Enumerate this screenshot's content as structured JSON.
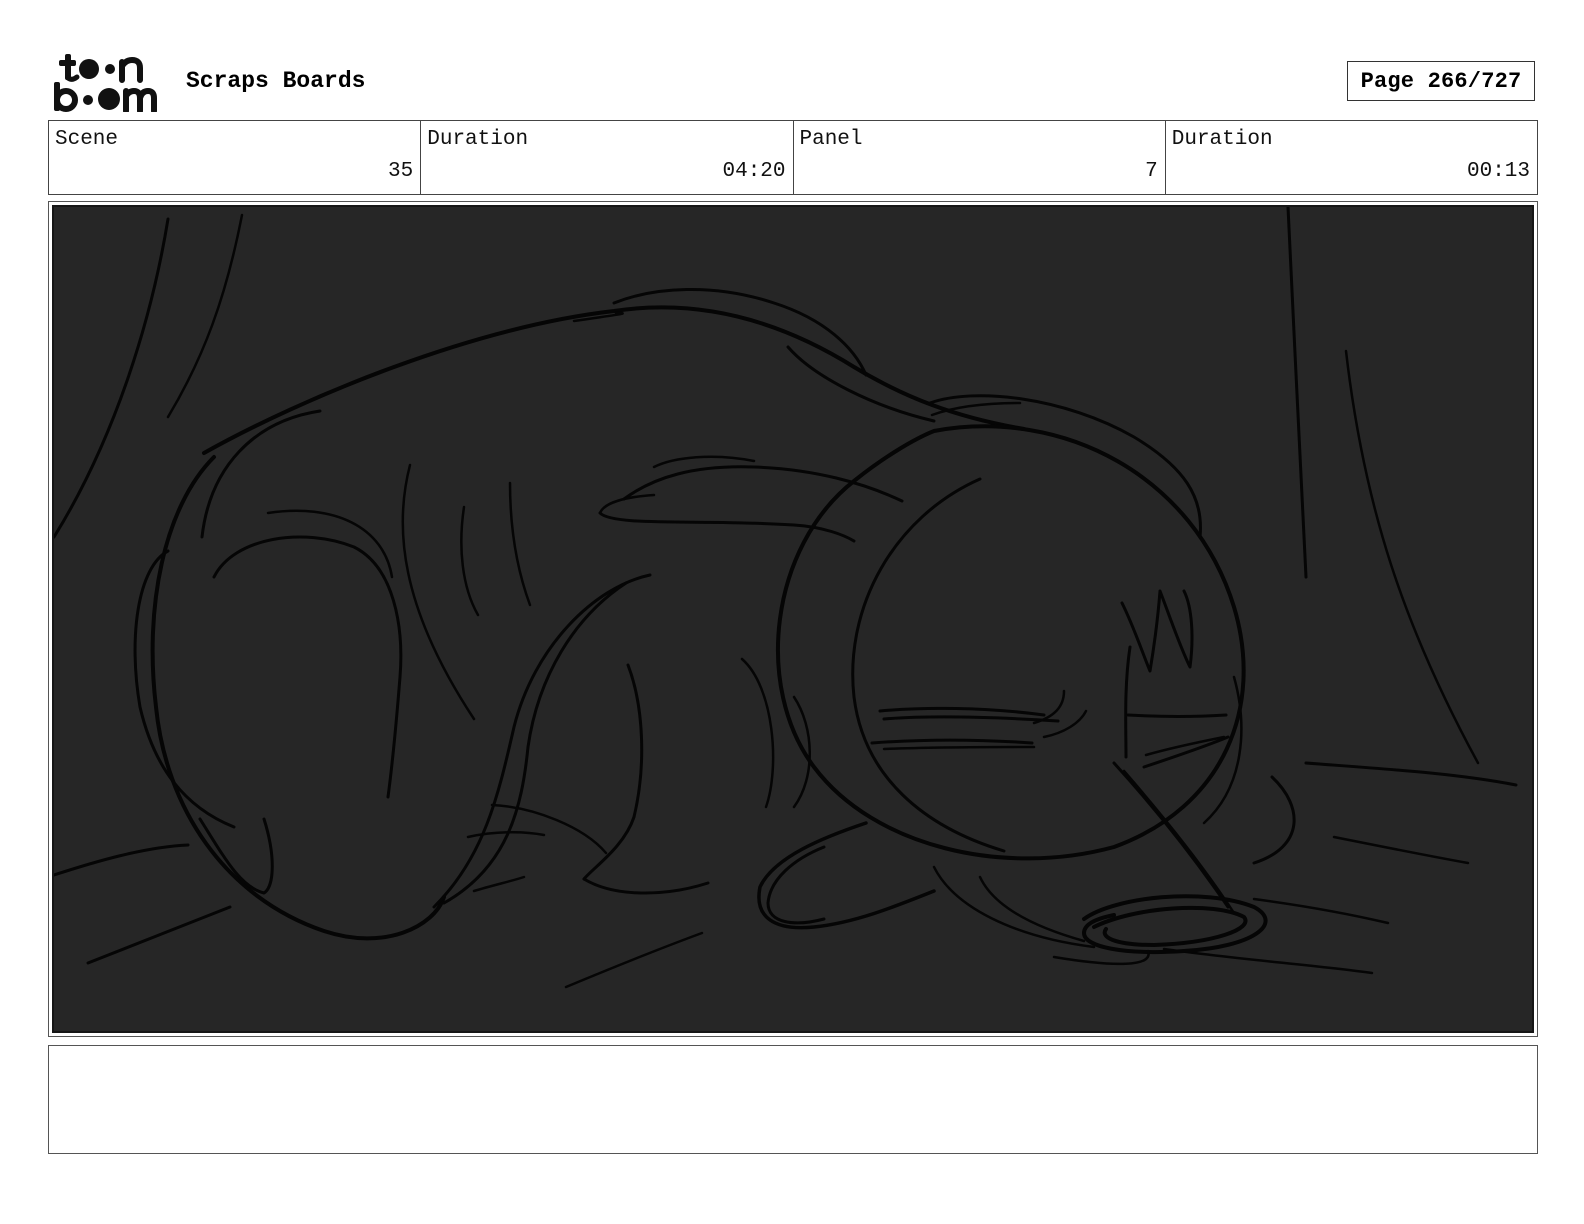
{
  "header": {
    "logo_text": "toon boom",
    "title": "Scraps Boards",
    "page_label": "Page 266/727"
  },
  "info": [
    {
      "label": "Scene",
      "value": "35"
    },
    {
      "label": "Duration",
      "value": "04:20"
    },
    {
      "label": "Panel",
      "value": "7"
    },
    {
      "label": "Duration",
      "value": "00:13"
    }
  ],
  "panel": {
    "background_color": "#262626",
    "line_color": "#050505",
    "notes": ""
  }
}
